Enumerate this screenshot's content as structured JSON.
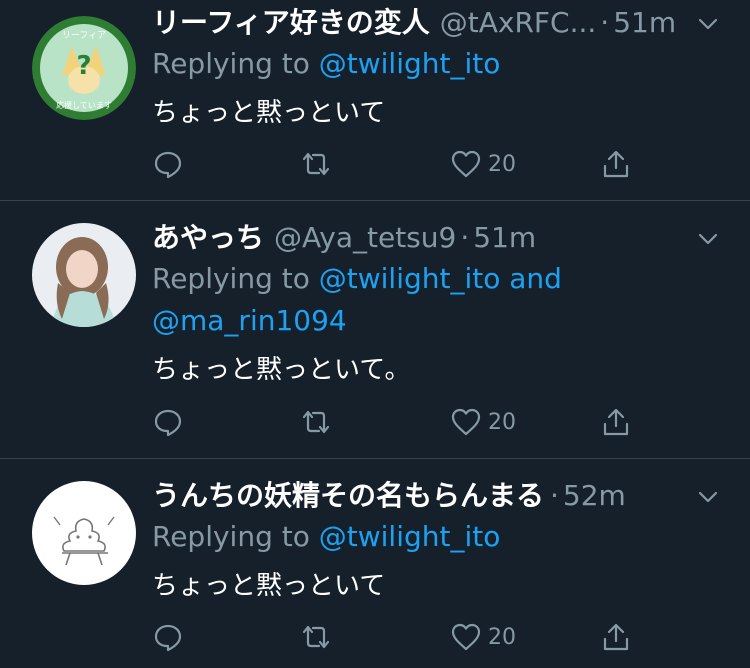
{
  "tweets": [
    {
      "name": "リーフィア好きの変人",
      "handle": "@tAxRFC...",
      "sep": "·",
      "time": "51m",
      "reply_prefix": "Replying to ",
      "mentions": [
        "@twilight_ito"
      ],
      "mention_joiner": "",
      "text": "ちょっと黙っといて",
      "likes": "20",
      "avatar_text_top": "リーフィア",
      "avatar_text_bottom": "応援しています",
      "avatar_colors": {
        "ring": "#2e7d32",
        "fill": "#b9e3c6",
        "ears": "#f2d27a"
      }
    },
    {
      "name": "あやっち",
      "handle": "@Aya_tetsu9",
      "sep": "·",
      "time": "51m",
      "reply_prefix": "Replying to ",
      "mentions": [
        "@twilight_ito",
        "@ma_rin1094"
      ],
      "mention_joiner": " and",
      "text": "ちょっと黙っといて。",
      "likes": "20",
      "avatar_colors": {
        "bg": "#eaeef2",
        "hair": "#8a6b55",
        "skin": "#f1d5c6",
        "dress": "#b7ddd8"
      }
    },
    {
      "name": "うんちの妖精その名もらんまる",
      "handle": "",
      "sep": "·",
      "time": "52m",
      "reply_prefix": "Replying to ",
      "mentions": [
        "@twilight_ito"
      ],
      "mention_joiner": "",
      "text": "ちょっと黙っといて",
      "likes": "20",
      "avatar_colors": {
        "bg": "#ffffff",
        "line": "#777777"
      }
    }
  ],
  "icons": {
    "reply": "comment-bubble-icon",
    "retweet": "retweet-arrows-icon",
    "like": "heart-icon",
    "share": "share-upload-icon",
    "caret": "chevron-down-icon"
  },
  "colors": {
    "background": "#15202b",
    "divider": "#38444d",
    "muted": "#8899a6",
    "accent": "#1da1f2",
    "text": "#ffffff"
  }
}
